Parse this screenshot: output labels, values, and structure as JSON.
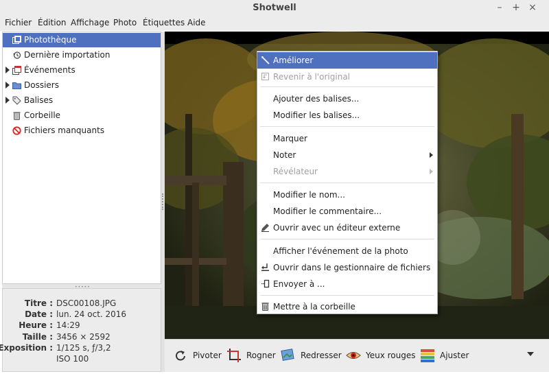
{
  "window": {
    "title": "Shotwell",
    "minimize_glyph": "–",
    "maximize_glyph": "+",
    "close_glyph": "×"
  },
  "menubar": {
    "items": [
      "Fichier",
      "Édition",
      "Affichage",
      "Photo",
      "Étiquettes",
      "Aide"
    ]
  },
  "sidebar": {
    "items": [
      {
        "label": "Photothèque",
        "icon": "library-icon",
        "selected": true,
        "expandable": false
      },
      {
        "label": "Dernière importation",
        "icon": "history-icon",
        "selected": false,
        "expandable": false
      },
      {
        "label": "Événements",
        "icon": "events-icon",
        "selected": false,
        "expandable": true
      },
      {
        "label": "Dossiers",
        "icon": "folder-icon",
        "selected": false,
        "expandable": true
      },
      {
        "label": "Balises",
        "icon": "tag-icon",
        "selected": false,
        "expandable": true
      },
      {
        "label": "Corbeille",
        "icon": "trash-icon",
        "selected": false,
        "expandable": false
      },
      {
        "label": "Fichiers manquants",
        "icon": "missing-files-icon",
        "selected": false,
        "expandable": false
      }
    ]
  },
  "properties": {
    "rows": [
      {
        "key": "Titre :",
        "value": "DSC00108.JPG"
      },
      {
        "key": "Date :",
        "value": "lun. 24 oct. 2016"
      },
      {
        "key": "Heure :",
        "value": "14:29"
      },
      {
        "key": "Taille :",
        "value": "3456 × 2592"
      },
      {
        "key": "Exposition :",
        "value": "1/125 s, ƒ/3,2"
      },
      {
        "key": "",
        "value": "ISO 100"
      }
    ]
  },
  "toolbar": {
    "buttons": [
      {
        "label": "Pivoter",
        "icon": "rotate-icon"
      },
      {
        "label": "Rogner",
        "icon": "crop-icon"
      },
      {
        "label": "Redresser",
        "icon": "straighten-icon"
      },
      {
        "label": "Yeux rouges",
        "icon": "red-eye-icon"
      },
      {
        "label": "Ajuster",
        "icon": "adjust-icon"
      }
    ]
  },
  "context_menu": {
    "items": [
      {
        "label": "Améliorer",
        "icon": "enhance-icon",
        "highlighted": true,
        "disabled": false,
        "submenu": false
      },
      {
        "label": "Revenir à l'original",
        "icon": "revert-icon",
        "highlighted": false,
        "disabled": true,
        "submenu": false
      },
      {
        "separator": true
      },
      {
        "label": "Ajouter des balises...",
        "highlighted": false,
        "disabled": false,
        "submenu": false
      },
      {
        "label": "Modifier les balises...",
        "highlighted": false,
        "disabled": false,
        "submenu": false
      },
      {
        "separator": true
      },
      {
        "label": "Marquer",
        "highlighted": false,
        "disabled": false,
        "submenu": false
      },
      {
        "label": "Noter",
        "highlighted": false,
        "disabled": false,
        "submenu": true
      },
      {
        "label": "Révélateur",
        "highlighted": false,
        "disabled": true,
        "submenu": true
      },
      {
        "separator": true
      },
      {
        "label": "Modifier le nom...",
        "highlighted": false,
        "disabled": false,
        "submenu": false
      },
      {
        "label": "Modifier le commentaire...",
        "highlighted": false,
        "disabled": false,
        "submenu": false
      },
      {
        "label": "Ouvrir avec un éditeur externe",
        "icon": "external-editor-icon",
        "highlighted": false,
        "disabled": false,
        "submenu": false
      },
      {
        "separator": true
      },
      {
        "label": "Afficher l'événement de la photo",
        "highlighted": false,
        "disabled": false,
        "submenu": false
      },
      {
        "label": "Ouvrir dans le gestionnaire de fichiers",
        "icon": "open-folder-icon",
        "highlighted": false,
        "disabled": false,
        "submenu": false
      },
      {
        "label": "Envoyer à ...",
        "icon": "send-to-icon",
        "highlighted": false,
        "disabled": false,
        "submenu": false
      },
      {
        "separator": true
      },
      {
        "label": "Mettre à la corbeille",
        "icon": "trash-icon",
        "highlighted": false,
        "disabled": false,
        "submenu": false
      }
    ]
  },
  "colors": {
    "selection": "#4f6fbf",
    "chrome": "#ececec",
    "viewer_background": "#000000"
  }
}
